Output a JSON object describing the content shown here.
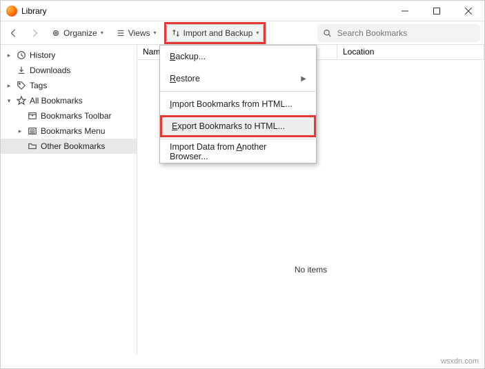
{
  "window": {
    "title": "Library"
  },
  "toolbar": {
    "organize": "Organize",
    "views": "Views",
    "import_backup": "Import and Backup",
    "search_placeholder": "Search Bookmarks"
  },
  "sidebar": {
    "history": "History",
    "downloads": "Downloads",
    "tags": "Tags",
    "all_bookmarks": "All Bookmarks",
    "toolbar": "Bookmarks Toolbar",
    "menu": "Bookmarks Menu",
    "other": "Other Bookmarks"
  },
  "columns": {
    "name": "Name",
    "location": "Location"
  },
  "list": {
    "empty": "No items"
  },
  "menu": {
    "backup": "Backup...",
    "restore": "Restore",
    "import_html": "Import Bookmarks from HTML...",
    "export_html": "Export Bookmarks to HTML...",
    "import_browser": "Import Data from Another Browser..."
  },
  "watermark": "wsxdn.com"
}
